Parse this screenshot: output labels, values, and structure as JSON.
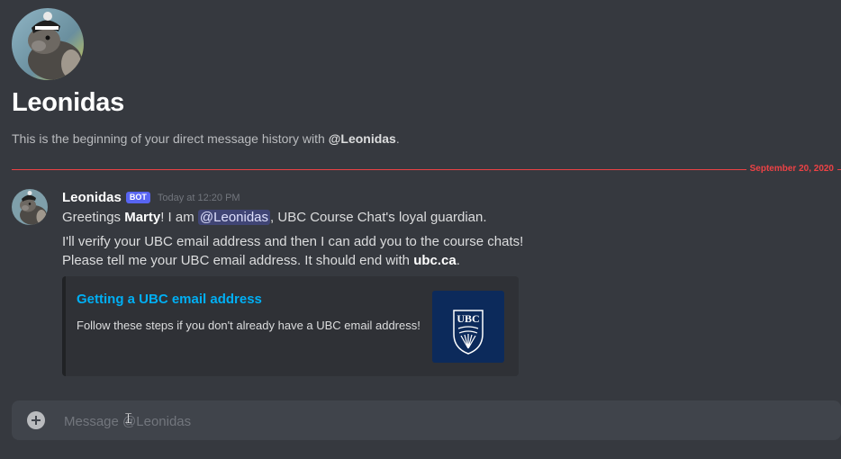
{
  "dm_header": {
    "title": "Leonidas",
    "subtitle_prefix": "This is the beginning of your direct message history with ",
    "subtitle_handle": "@Leonidas",
    "subtitle_suffix": "."
  },
  "date_divider": "September 20, 2020",
  "message": {
    "author": "Leonidas",
    "bot_tag": "BOT",
    "timestamp": "Today at 12:20 PM",
    "line1": {
      "greeting": "Greetings ",
      "name": "Marty",
      "mid": "! I am ",
      "mention": "@Leonidas",
      "end": ", UBC Course Chat's loyal guardian."
    },
    "line2": "I'll verify your UBC email address and then I can add you to the course chats!",
    "line3": {
      "start": "Please tell me your UBC email address. It should end with ",
      "bold": "ubc.ca",
      "end": "."
    }
  },
  "embed": {
    "title": "Getting a UBC email address",
    "description": "Follow these steps if you don't already have a UBC email address!",
    "thumbnail_text": "UBC"
  },
  "composer": {
    "placeholder": "Message @Leonidas",
    "add_icon": "plus-circle-icon"
  },
  "colors": {
    "background": "#36393f",
    "divider": "#ed4245",
    "bot_tag": "#5865f2",
    "link": "#00aff4",
    "ubc_blue": "#0c2a5b"
  }
}
